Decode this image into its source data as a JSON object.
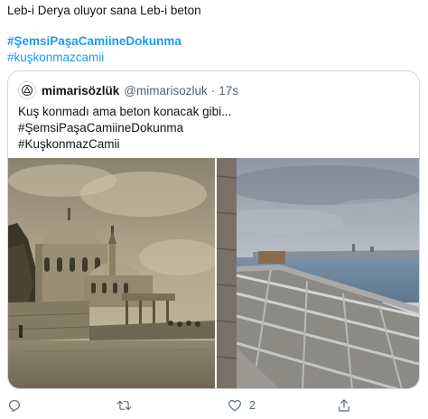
{
  "tweet": {
    "text_line": "Leb-i Derya oluyor sana Leb-i beton",
    "hashtag_1": "#ŞemsiPaşaCamiineDokunma",
    "hashtag_2": "#kuşkonmazcamii"
  },
  "quote": {
    "display_name": "mimarisözlük",
    "handle": "@mimarisozluk",
    "separator": "·",
    "time": "17s",
    "line_1": "Kuş konmadı ama beton konacak gibi...",
    "line_2": "#ŞemsiPaşaCamiineDokunma",
    "line_3": "#KuşkonmazCamii"
  },
  "actions": {
    "like_count": "2"
  },
  "icons": {
    "reply": "reply-icon",
    "retweet": "retweet-icon",
    "like": "heart-icon",
    "share": "share-icon"
  },
  "colors": {
    "accent": "#1d9bf0",
    "secondary_text": "#536471",
    "border": "#cfd9de"
  }
}
